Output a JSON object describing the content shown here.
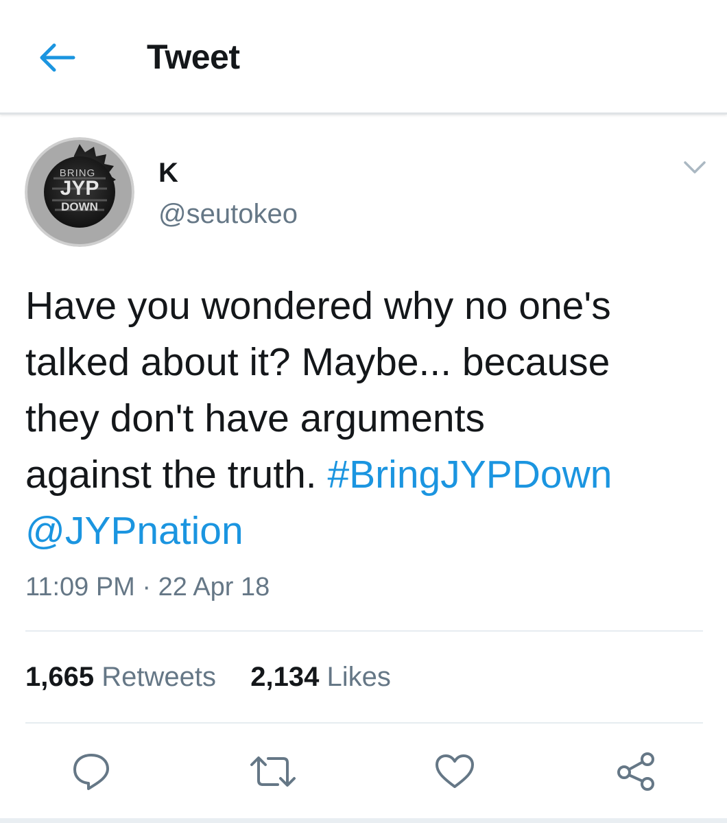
{
  "header": {
    "back_icon": "arrow-left-icon",
    "title": "Tweet",
    "accent_color": "#1b95e0"
  },
  "tweet": {
    "avatar_text": {
      "line1": "BRING",
      "line2": "JYP",
      "line3": "DOWN"
    },
    "display_name": "K",
    "handle": "@seutokeo",
    "caret_icon": "chevron-down-icon",
    "text_lines": [
      "Have you wondered why no one's",
      "talked about it? Maybe... because",
      "they don't have arguments",
      "against the truth. "
    ],
    "hashtag": "#BringJYPDown",
    "mention": "@JYPnation",
    "timestamp": "11:09 PM · 22 Apr 18"
  },
  "stats": {
    "retweets_count": "1,665",
    "retweets_label": "Retweets",
    "likes_count": "2,134",
    "likes_label": "Likes"
  },
  "actions": [
    {
      "icon": "reply-icon"
    },
    {
      "icon": "retweet-icon"
    },
    {
      "icon": "like-heart-icon"
    },
    {
      "icon": "share-icon"
    }
  ],
  "colors": {
    "text": "#14171a",
    "secondary": "#657786",
    "link": "#1b95e0",
    "divider": "#e6ecf0"
  }
}
